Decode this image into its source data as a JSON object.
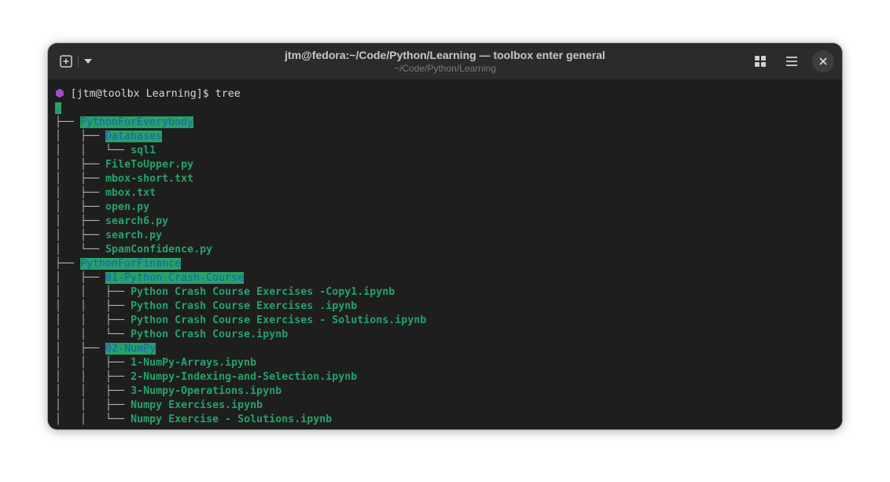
{
  "window": {
    "title": "jtm@fedora:~/Code/Python/Learning — toolbox enter general",
    "subtitle": "~/Code/Python/Learning"
  },
  "colors": {
    "file_green": "#26a269",
    "dir_blue": "#1a5fb4",
    "prompt_purple": "#a34cd4",
    "background": "#1e1e1e",
    "titlebar": "#2b2b2b"
  },
  "icons": {
    "new_tab": "new-tab-icon",
    "dropdown": "chevron-down-icon",
    "grid": "grid-icon",
    "menu": "hamburger-menu-icon",
    "close": "close-icon",
    "prompt": "hexagon-icon"
  },
  "terminal": {
    "prompt_glyph": "⬢",
    "prompt_text": " [jtm@toolbx Learning]$ tree",
    "root": ".",
    "tree_lines": [
      {
        "prefix": "├── ",
        "name": "PythonForEverybody",
        "kind": "dir"
      },
      {
        "prefix": "│   ├── ",
        "name": "Databases",
        "kind": "dir"
      },
      {
        "prefix": "│   │   └── ",
        "name": "sql1",
        "kind": "file"
      },
      {
        "prefix": "│   ├── ",
        "name": "FileToUpper.py",
        "kind": "file"
      },
      {
        "prefix": "│   ├── ",
        "name": "mbox-short.txt",
        "kind": "file"
      },
      {
        "prefix": "│   ├── ",
        "name": "mbox.txt",
        "kind": "file"
      },
      {
        "prefix": "│   ├── ",
        "name": "open.py",
        "kind": "file"
      },
      {
        "prefix": "│   ├── ",
        "name": "search6.py",
        "kind": "file"
      },
      {
        "prefix": "│   ├── ",
        "name": "search.py",
        "kind": "file"
      },
      {
        "prefix": "│   └── ",
        "name": "SpamConfidence.py",
        "kind": "file"
      },
      {
        "prefix": "├── ",
        "name": "PythonForFinance",
        "kind": "dir"
      },
      {
        "prefix": "│   ├── ",
        "name": "01-Python-Crash-Course",
        "kind": "dir"
      },
      {
        "prefix": "│   │   ├── ",
        "name": "Python Crash Course Exercises -Copy1.ipynb",
        "kind": "file"
      },
      {
        "prefix": "│   │   ├── ",
        "name": "Python Crash Course Exercises .ipynb",
        "kind": "file"
      },
      {
        "prefix": "│   │   ├── ",
        "name": "Python Crash Course Exercises - Solutions.ipynb",
        "kind": "file"
      },
      {
        "prefix": "│   │   └── ",
        "name": "Python Crash Course.ipynb",
        "kind": "file"
      },
      {
        "prefix": "│   ├── ",
        "name": "02-NumPy",
        "kind": "dir"
      },
      {
        "prefix": "│   │   ├── ",
        "name": "1-NumPy-Arrays.ipynb",
        "kind": "file"
      },
      {
        "prefix": "│   │   ├── ",
        "name": "2-Numpy-Indexing-and-Selection.ipynb",
        "kind": "file"
      },
      {
        "prefix": "│   │   ├── ",
        "name": "3-Numpy-Operations.ipynb",
        "kind": "file"
      },
      {
        "prefix": "│   │   ├── ",
        "name": "Numpy Exercises.ipynb",
        "kind": "file"
      },
      {
        "prefix": "│   │   └── ",
        "name": "Numpy Exercise - Solutions.ipynb",
        "kind": "file"
      }
    ]
  }
}
